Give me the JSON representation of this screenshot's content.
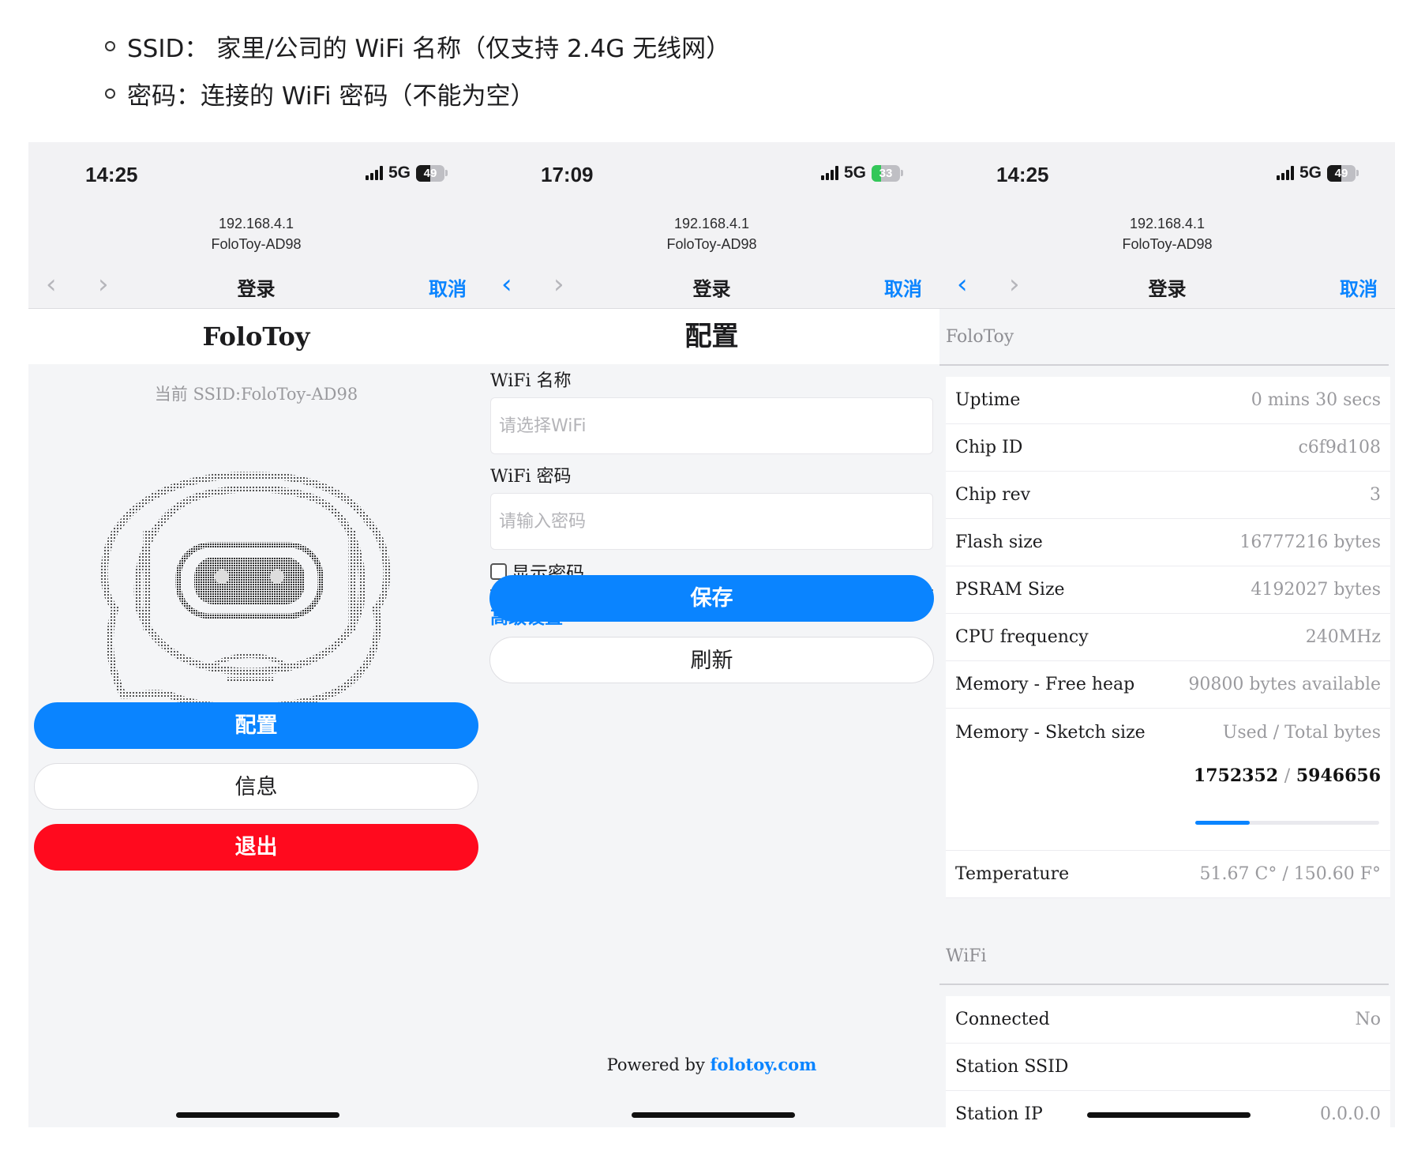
{
  "bullets": [
    "SSID： 家里/公司的 WiFi 名称（仅支持 2.4G 无线网）",
    "密码：连接的 WiFi 密码（不能为空）"
  ],
  "phones": [
    {
      "time": "14:25",
      "network": "5G",
      "battery": "49",
      "battery_level": 0.49,
      "url": "192.168.4.1",
      "site": "FoloToy-AD98",
      "nav_title": "登录",
      "cancel": "取消",
      "back_icon": "chevron-left-icon",
      "forward_icon": "chevron-right-icon"
    },
    {
      "time": "17:09",
      "network": "5G",
      "battery": "33",
      "battery_level": 0.33,
      "url": "192.168.4.1",
      "site": "FoloToy-AD98",
      "nav_title": "登录",
      "cancel": "取消"
    },
    {
      "time": "14:25",
      "network": "5G",
      "battery": "49",
      "battery_level": 0.49,
      "url": "192.168.4.1",
      "site": "FoloToy-AD98",
      "nav_title": "登录",
      "cancel": "取消"
    }
  ],
  "login": {
    "heading": "FoloToy",
    "ssid": "当前 SSID:FoloToy-AD98",
    "config_button": "配置",
    "info_button": "信息",
    "exit_button": "退出"
  },
  "config": {
    "heading": "配置",
    "wifi_name_label": "WiFi 名称",
    "wifi_name_placeholder": "请选择WiFi",
    "wifi_password_label": "WiFi 密码",
    "wifi_password_placeholder": "请输入密码",
    "show_password": "显示密码",
    "advanced": "高级设置",
    "save_button": "保存",
    "refresh_button": "刷新",
    "powered_by": "Powered by",
    "powered_link": "folotoy.com"
  },
  "info": {
    "section1": "FoloToy",
    "rows": [
      {
        "k": "Uptime",
        "v": "0 mins 30 secs"
      },
      {
        "k": "Chip ID",
        "v": "c6f9d108"
      },
      {
        "k": "Chip rev",
        "v": "3"
      },
      {
        "k": "Flash size",
        "v": "16777216 bytes"
      },
      {
        "k": "PSRAM Size",
        "v": "4192027 bytes"
      },
      {
        "k": "CPU frequency",
        "v": "240MHz"
      },
      {
        "k": "Memory - Free heap",
        "v": "90800 bytes available"
      },
      {
        "k": "Memory - Sketch size",
        "v": "Used / Total bytes"
      }
    ],
    "sketch_used": "1752352",
    "sketch_sep": "/",
    "sketch_total": "5946656",
    "sketch_fraction": 0.2947,
    "temperature_label": "Temperature",
    "temperature_value": "51.67 C° / 150.60 F°",
    "section2": "WiFi",
    "wifi_rows": [
      {
        "k": "Connected",
        "v": "No"
      },
      {
        "k": "Station SSID",
        "v": ""
      },
      {
        "k": "Station IP",
        "v": "0.0.0.0"
      }
    ]
  },
  "colors": {
    "accent": "#0a84ff",
    "danger": "#ff0a1e",
    "battery_green": "#34c759"
  }
}
